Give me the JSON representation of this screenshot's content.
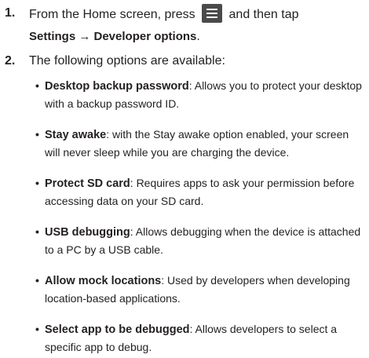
{
  "steps": [
    {
      "number": "1.",
      "text_before_icon": "From the Home screen, press",
      "icon": "menu-key-icon",
      "text_after_icon": "and then tap",
      "path": "Settings → Developer options",
      "path_end": "."
    },
    {
      "number": "2.",
      "text": "The following options are available:"
    }
  ],
  "options": [
    {
      "term": "Desktop backup password",
      "description": ": Allows you to protect your desktop with a backup password ID."
    },
    {
      "term": "Stay awake",
      "description": ": with the Stay awake option enabled, your screen will never sleep while you are charging the device."
    },
    {
      "term": "Protect SD card",
      "description": ": Requires apps to ask your permission before accessing data on your SD card."
    },
    {
      "term": "USB debugging",
      "description": ": Allows debugging when the device is attached to a PC by a USB cable."
    },
    {
      "term": "Allow mock locations",
      "description": ": Used by developers when developing location-based applications."
    },
    {
      "term": "Select app to be debugged",
      "description": ": Allows developers to select a specific app to debug."
    }
  ],
  "bullet_char": "•",
  "colors": {
    "text": "#231f20",
    "menu_key_bg": "#4a4a4a",
    "menu_key_glyph": "#ffffff"
  }
}
